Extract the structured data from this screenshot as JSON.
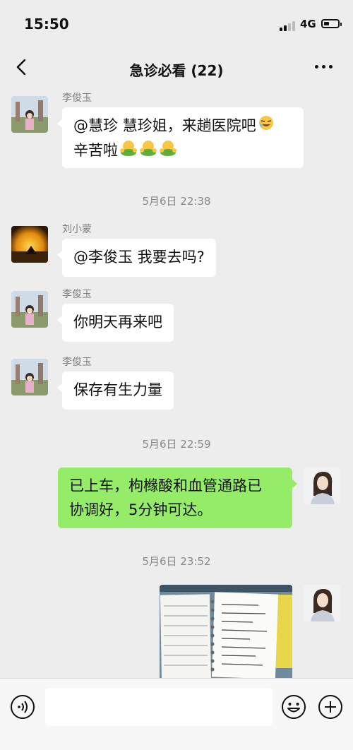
{
  "status_bar": {
    "time": "15:50",
    "network": "4G"
  },
  "header": {
    "back_icon": "chevron-left-icon",
    "title": "急诊必看 (22)",
    "more_icon": "more-dots-icon"
  },
  "messages": {
    "m1": {
      "sender": "李俊玉",
      "line1": "@慧珍 慧珍姐，来趟医院吧",
      "line2": "辛苦啦"
    },
    "ts1": "5月6日 22:38",
    "m2": {
      "sender": "刘小蒙",
      "text": "@李俊玉 我要去吗?"
    },
    "m3": {
      "sender": "李俊玉",
      "text": "你明天再来吧"
    },
    "m4": {
      "sender": "李俊玉",
      "text": "保存有生力量"
    },
    "ts2": "5月6日 22:59",
    "m5": {
      "line1": "已上车，枸橼酸和血管通路已",
      "line2": "协调好，5分钟可达。"
    },
    "ts3": "5月6日 23:52"
  },
  "input_bar": {
    "voice_icon": "voice-icon",
    "emoji_icon": "emoji-icon",
    "plus_icon": "plus-icon",
    "placeholder": ""
  },
  "colors": {
    "background": "#ededed",
    "own_bubble": "#95ec69",
    "other_bubble": "#ffffff"
  }
}
